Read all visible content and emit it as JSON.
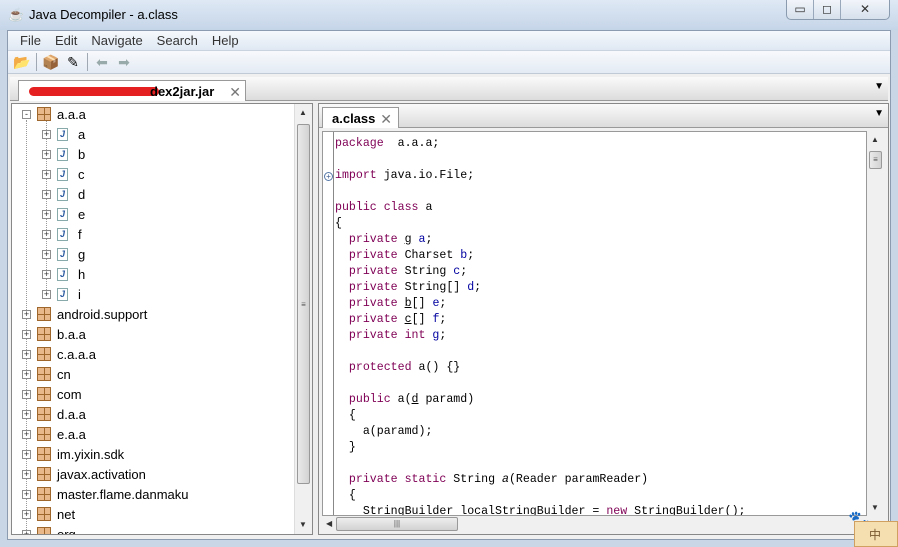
{
  "window": {
    "title": "Java Decompiler - a.class",
    "app_icon": "coffee-cup-icon",
    "controls": [
      "minimize-icon",
      "maximize-icon",
      "close-icon"
    ]
  },
  "menu": [
    "File",
    "Edit",
    "Navigate",
    "Search",
    "Help"
  ],
  "toolbar": [
    {
      "name": "open-file-icon",
      "glyph": "📂"
    },
    {
      "name": "open-type-icon",
      "glyph": "📦"
    },
    {
      "name": "search-icon",
      "glyph": "✎"
    },
    {
      "name": "back-icon",
      "glyph": "⬅"
    },
    {
      "name": "forward-icon",
      "glyph": "➡"
    }
  ],
  "outer_tab": {
    "label": "dex2jar.jar",
    "redacted": true,
    "redaction_color": "#e52020"
  },
  "tree": {
    "root": {
      "label": "a.a.a",
      "expanded": true,
      "children": [
        "a",
        "b",
        "c",
        "d",
        "e",
        "f",
        "g",
        "h",
        "i"
      ]
    },
    "packages": [
      "android.support",
      "b.a.a",
      "c.a.a.a",
      "cn",
      "com",
      "d.a.a",
      "e.a.a",
      "im.yixin.sdk",
      "javax.activation",
      "master.flame.danmaku",
      "net",
      "org"
    ]
  },
  "inner_tab": {
    "label": "a.class"
  },
  "code": [
    [
      [
        "kw",
        "package"
      ],
      [
        "",
        "  a.a.a;"
      ]
    ],
    [],
    [
      [
        "kw",
        "import"
      ],
      [
        "",
        " java.io.File;"
      ]
    ],
    [],
    [
      [
        "kw",
        "public class"
      ],
      [
        "",
        " a"
      ]
    ],
    [
      [
        "",
        "{"
      ]
    ],
    [
      [
        "",
        "  "
      ],
      [
        "kw",
        "private"
      ],
      [
        "",
        " "
      ],
      [
        "ul",
        "g"
      ],
      [
        "",
        " "
      ],
      [
        "fld",
        "a"
      ],
      [
        "",
        ";"
      ]
    ],
    [
      [
        "",
        "  "
      ],
      [
        "kw",
        "private"
      ],
      [
        "",
        " Charset "
      ],
      [
        "fld",
        "b"
      ],
      [
        "",
        ";"
      ]
    ],
    [
      [
        "",
        "  "
      ],
      [
        "kw",
        "private"
      ],
      [
        "",
        " String "
      ],
      [
        "fld",
        "c"
      ],
      [
        "",
        ";"
      ]
    ],
    [
      [
        "",
        "  "
      ],
      [
        "kw",
        "private"
      ],
      [
        "",
        " String[] "
      ],
      [
        "fld",
        "d"
      ],
      [
        "",
        ";"
      ]
    ],
    [
      [
        "",
        "  "
      ],
      [
        "kw",
        "private"
      ],
      [
        "",
        " "
      ],
      [
        "ul",
        "b"
      ],
      [
        "",
        "[] "
      ],
      [
        "fld",
        "e"
      ],
      [
        "",
        ";"
      ]
    ],
    [
      [
        "",
        "  "
      ],
      [
        "kw",
        "private"
      ],
      [
        "",
        " "
      ],
      [
        "ul",
        "c"
      ],
      [
        "",
        "[] "
      ],
      [
        "fld",
        "f"
      ],
      [
        "",
        ";"
      ]
    ],
    [
      [
        "",
        "  "
      ],
      [
        "kw",
        "private int"
      ],
      [
        "",
        " "
      ],
      [
        "fld",
        "g"
      ],
      [
        "",
        ";"
      ]
    ],
    [],
    [
      [
        "",
        "  "
      ],
      [
        "kw",
        "protected"
      ],
      [
        "",
        " a() {}"
      ]
    ],
    [],
    [
      [
        "",
        "  "
      ],
      [
        "kw",
        "public"
      ],
      [
        "",
        " a("
      ],
      [
        "ul",
        "d"
      ],
      [
        "",
        " paramd)"
      ]
    ],
    [
      [
        "",
        "  {"
      ]
    ],
    [
      [
        "",
        "    a(paramd);"
      ]
    ],
    [
      [
        "",
        "  }"
      ]
    ],
    [],
    [
      [
        "",
        "  "
      ],
      [
        "kw",
        "private static"
      ],
      [
        "",
        " String "
      ],
      [
        "it",
        "a"
      ],
      [
        "",
        "(Reader paramReader)"
      ]
    ],
    [
      [
        "",
        "  {"
      ]
    ],
    [
      [
        "",
        "    StringBuilder localStringBuilder = "
      ],
      [
        "kw",
        "new"
      ],
      [
        "",
        " StringBuilder();"
      ]
    ]
  ],
  "fold_markers": [
    2
  ],
  "ime": {
    "label": "中"
  },
  "colors": {
    "keyword": "#7f0055",
    "field": "#0000a0",
    "titlebar": "#c5d5e8"
  }
}
